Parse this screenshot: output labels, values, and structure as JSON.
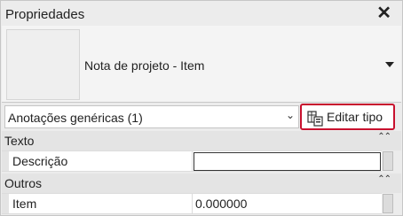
{
  "window": {
    "title": "Propriedades",
    "close_glyph": "✕"
  },
  "type_selector": {
    "type_name": "Nota de projeto - Item"
  },
  "filter": {
    "selected": "Anotações genéricas (1)",
    "chevron_glyph": "⌄"
  },
  "edit_type": {
    "label": "Editar tipo",
    "icon": "edit-type-icon"
  },
  "sections": [
    {
      "title": "Texto",
      "collapse_glyph": "⌃⌃",
      "properties": [
        {
          "name": "Descrição",
          "value": ""
        }
      ]
    },
    {
      "title": "Outros",
      "collapse_glyph": "⌃⌃",
      "properties": [
        {
          "name": "Item",
          "value": "0.000000"
        }
      ]
    }
  ],
  "colors": {
    "highlight": "#c8102e",
    "panel": "#ececec"
  }
}
